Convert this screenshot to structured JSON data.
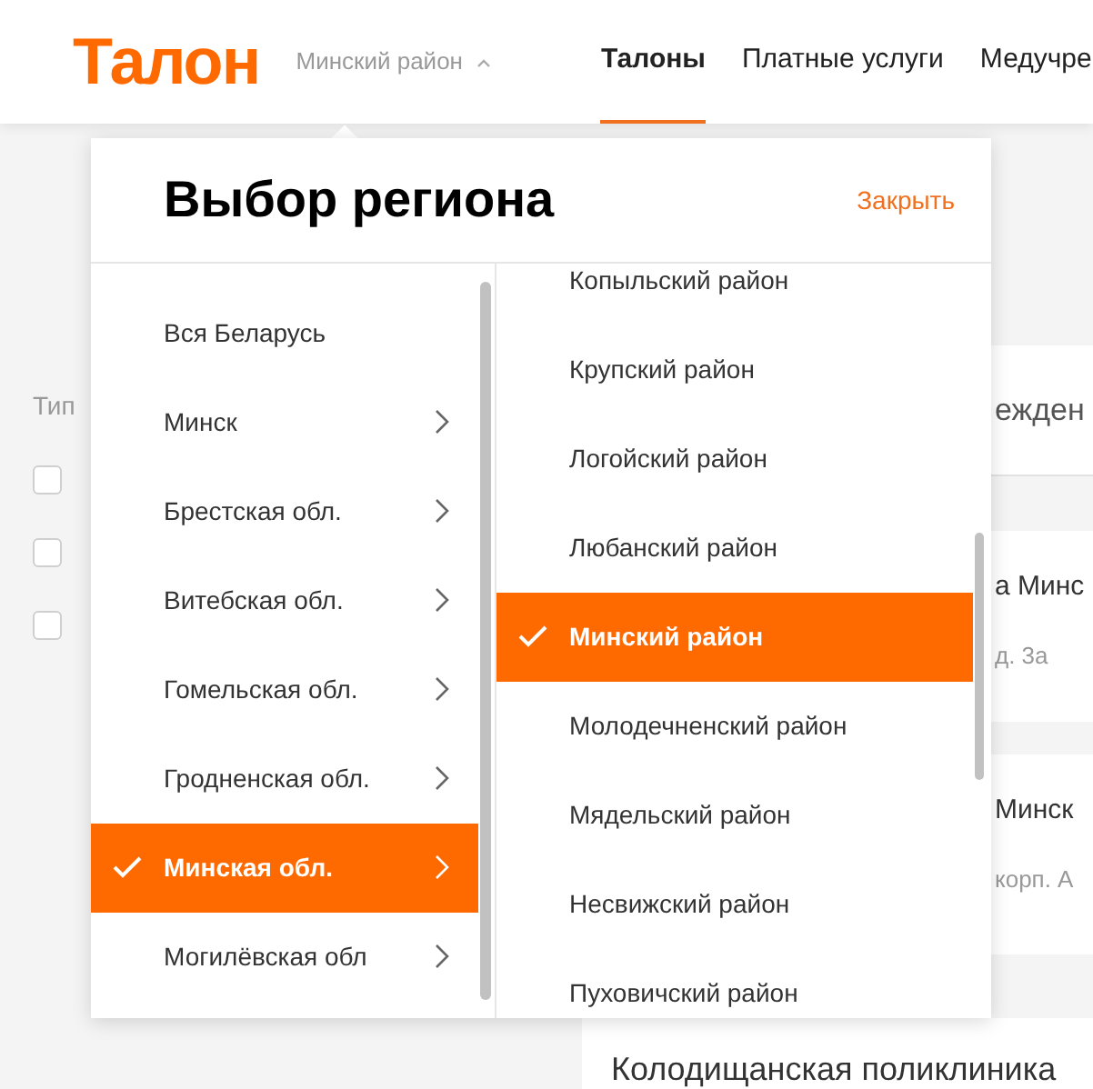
{
  "header": {
    "logo": "Талон",
    "region": "Минский район",
    "nav": [
      {
        "label": "Талоны",
        "selected": true
      },
      {
        "label": "Платные услуги",
        "selected": false
      },
      {
        "label": "Медучре",
        "selected": false
      }
    ]
  },
  "background": {
    "filter_title": "Тип",
    "filter_checkboxes": [
      {
        "checked": false
      },
      {
        "checked": false
      },
      {
        "checked": false
      }
    ],
    "search_text": "ежден",
    "cards": [
      {
        "title": "а Минс",
        "address": "д. 3а"
      },
      {
        "title": "Минск",
        "address": "корп. А"
      },
      {
        "title": "Колодищанская поликлиника"
      }
    ]
  },
  "region_dialog": {
    "title": "Выбор региона",
    "close": "Закрыть",
    "regions": [
      {
        "label": "Вся Беларусь",
        "selected": false,
        "has_children": false
      },
      {
        "label": "Минск",
        "selected": false,
        "has_children": true
      },
      {
        "label": "Брестская обл.",
        "selected": false,
        "has_children": true
      },
      {
        "label": "Витебская обл.",
        "selected": false,
        "has_children": true
      },
      {
        "label": "Гомельская обл.",
        "selected": false,
        "has_children": true
      },
      {
        "label": "Гродненская обл.",
        "selected": false,
        "has_children": true
      },
      {
        "label": "Минская обл.",
        "selected": true,
        "has_children": true
      },
      {
        "label": "Могилёвская обл",
        "selected": false,
        "has_children": true
      }
    ],
    "districts": [
      {
        "label": "Копыльский район",
        "selected": false
      },
      {
        "label": "Крупский район",
        "selected": false
      },
      {
        "label": "Логойский район",
        "selected": false
      },
      {
        "label": "Любанский район",
        "selected": false
      },
      {
        "label": "Минский район",
        "selected": true
      },
      {
        "label": "Молодечненский район",
        "selected": false
      },
      {
        "label": "Мядельский район",
        "selected": false
      },
      {
        "label": "Несвижский район",
        "selected": false
      },
      {
        "label": "Пуховичский район",
        "selected": false
      }
    ]
  }
}
